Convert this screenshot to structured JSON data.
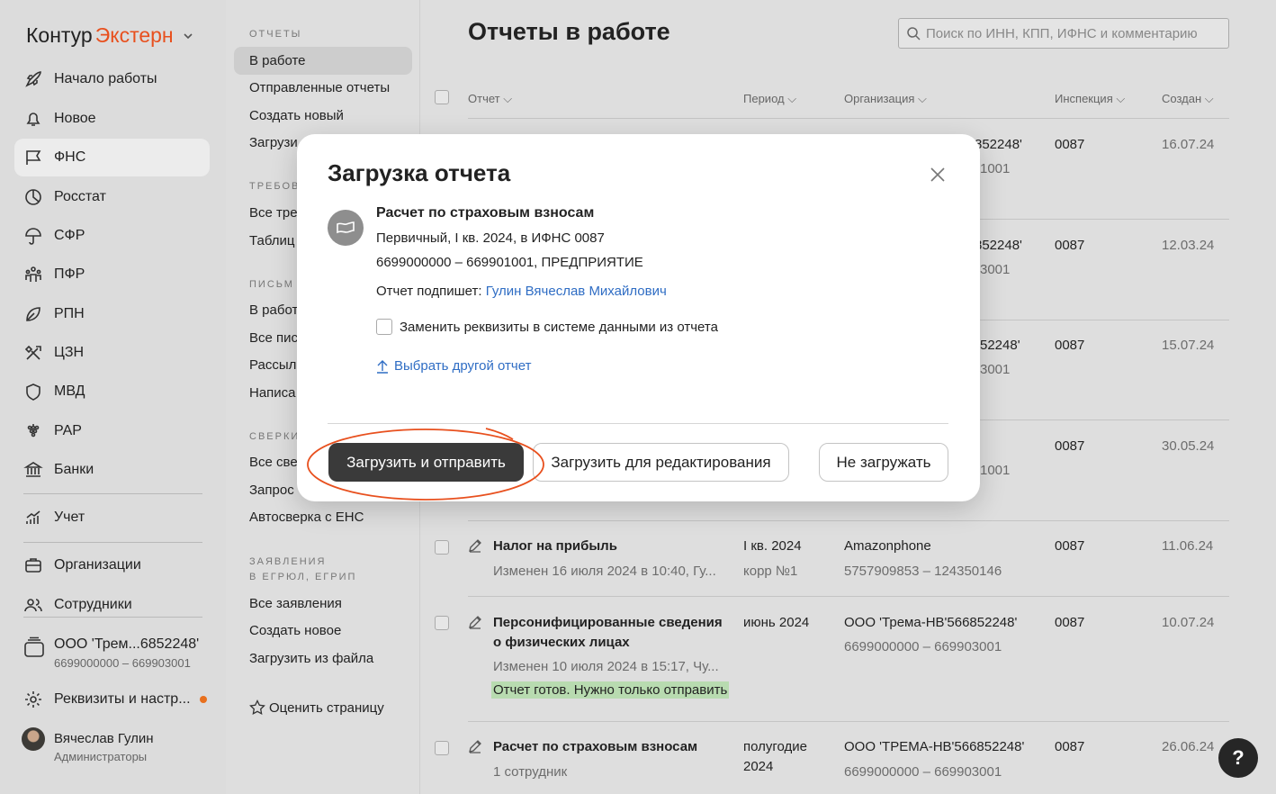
{
  "logo": {
    "part1": "Контур",
    "part2": "Экстерн"
  },
  "sidebar": {
    "items": [
      {
        "label": "Начало работы",
        "icon": "rocket-icon"
      },
      {
        "label": "Новое",
        "icon": "bell-icon"
      },
      {
        "label": "ФНС",
        "icon": "flag-icon"
      },
      {
        "label": "Росстат",
        "icon": "pie-chart-icon"
      },
      {
        "label": "СФР",
        "icon": "umbrella-icon"
      },
      {
        "label": "ПФР",
        "icon": "people-icon"
      },
      {
        "label": "РПН",
        "icon": "leaf-icon"
      },
      {
        "label": "ЦЗН",
        "icon": "tools-icon"
      },
      {
        "label": "МВД",
        "icon": "shield-icon"
      },
      {
        "label": "РАР",
        "icon": "grapes-icon"
      },
      {
        "label": "Банки",
        "icon": "bank-icon"
      },
      {
        "label": "Учет",
        "icon": "growth-icon"
      },
      {
        "label": "Организации",
        "icon": "briefcase-icon"
      },
      {
        "label": "Сотрудники",
        "icon": "users-icon"
      }
    ],
    "org": {
      "name": "ООО 'Трем...6852248'",
      "inn": "6699000000 – 669903001"
    },
    "settings": "Реквизиты и настр...",
    "user": {
      "name": "Вячеслав Гулин",
      "role": "Администраторы"
    }
  },
  "subnav": {
    "s1": {
      "header": "ОТЧЕТЫ",
      "items": [
        "В работе",
        "Отправленные отчеты",
        "Создать новый",
        "Загрузи"
      ]
    },
    "s2": {
      "header": "ТРЕБОВ",
      "items": [
        "Все тре",
        "Таблиц"
      ]
    },
    "s3": {
      "header": "ПИСЬМ",
      "items": [
        "В работ",
        "Все пис",
        "Рассыл",
        "Написа"
      ]
    },
    "s4": {
      "header": "СВЕРКИ",
      "items": [
        "Все све",
        "Запрос",
        "Автосверка с ЕНС"
      ]
    },
    "s5": {
      "header1": "ЗАЯВЛЕНИЯ",
      "header2": "В ЕГРЮЛ, ЕГРИП",
      "items": [
        "Все заявления",
        "Создать новое",
        "Загрузить из файла"
      ]
    },
    "rate": "Оценить страницу"
  },
  "main": {
    "title": "Отчеты в работе",
    "search_placeholder": "Поиск по ИНН, КПП, ИФНС и комментарию",
    "columns": [
      "Отчет",
      "Период",
      "Организация",
      "Инспекция",
      "Создан"
    ],
    "rows_top": [
      {
        "org1": "852248'",
        "org2": "1001",
        "insp": "0087",
        "date": "16.07.24"
      },
      {
        "org1": "852248'",
        "org2": "3001",
        "insp": "0087",
        "date": "12.03.24"
      },
      {
        "org1": "52248'",
        "org2": "3001",
        "insp": "0087",
        "date": "15.07.24"
      },
      {
        "org1": "",
        "org2": "1001",
        "insp": "0087",
        "date": "30.05.24"
      }
    ],
    "rows": [
      {
        "name": "Налог на прибыль",
        "sub": "Изменен 16 июля 2024 в 10:40, Гу...",
        "period1": "I кв. 2024",
        "period2": "корр №1",
        "org1": "Amazonphone",
        "org2": "5757909853 – 124350146",
        "insp": "0087",
        "date": "11.06.24"
      },
      {
        "name1": "Персонифицированные сведения",
        "name2": "о физических лицах",
        "sub": "Изменен 10 июля 2024 в 15:17, Чу...",
        "status": "Отчет готов. Нужно только отправить",
        "period1": "июнь 2024",
        "org1": "ООО 'Трема-НВ'566852248'",
        "org2": "6699000000 – 669903001",
        "insp": "0087",
        "date": "10.07.24"
      },
      {
        "name": "Расчет по страховым взносам",
        "sub": "1 сотрудник",
        "period1": "полугодие",
        "period2": "2024",
        "org1": "ООО 'ТРЕМА-НВ'566852248'",
        "org2": "6699000000 – 669903001",
        "insp": "0087",
        "date": "26.06.24"
      }
    ]
  },
  "modal": {
    "title": "Загрузка отчета",
    "report_name": "Расчет по страховым взносам",
    "details": "Первичный, I кв. 2024, в ИФНС 0087",
    "org": "6699000000 – 669901001, ПРЕДПРИЯТИЕ",
    "signer_label": "Отчет подпишет:",
    "signer_name": "Гулин Вячеслав Михайлович",
    "checkbox_label": "Заменить реквизиты в системе данными из отчета",
    "choose_other": "Выбрать другой отчет",
    "btn_upload_send": "Загрузить и отправить",
    "btn_upload_edit": "Загрузить для редактирования",
    "btn_cancel": "Не загружать"
  },
  "colors": {
    "accent": "#e8501e",
    "link": "#2f6dc4",
    "ready": "#b8dbb0",
    "primary_btn": "#3a3a3a",
    "highlight_ellipse": "#e8501e"
  },
  "help": "?"
}
